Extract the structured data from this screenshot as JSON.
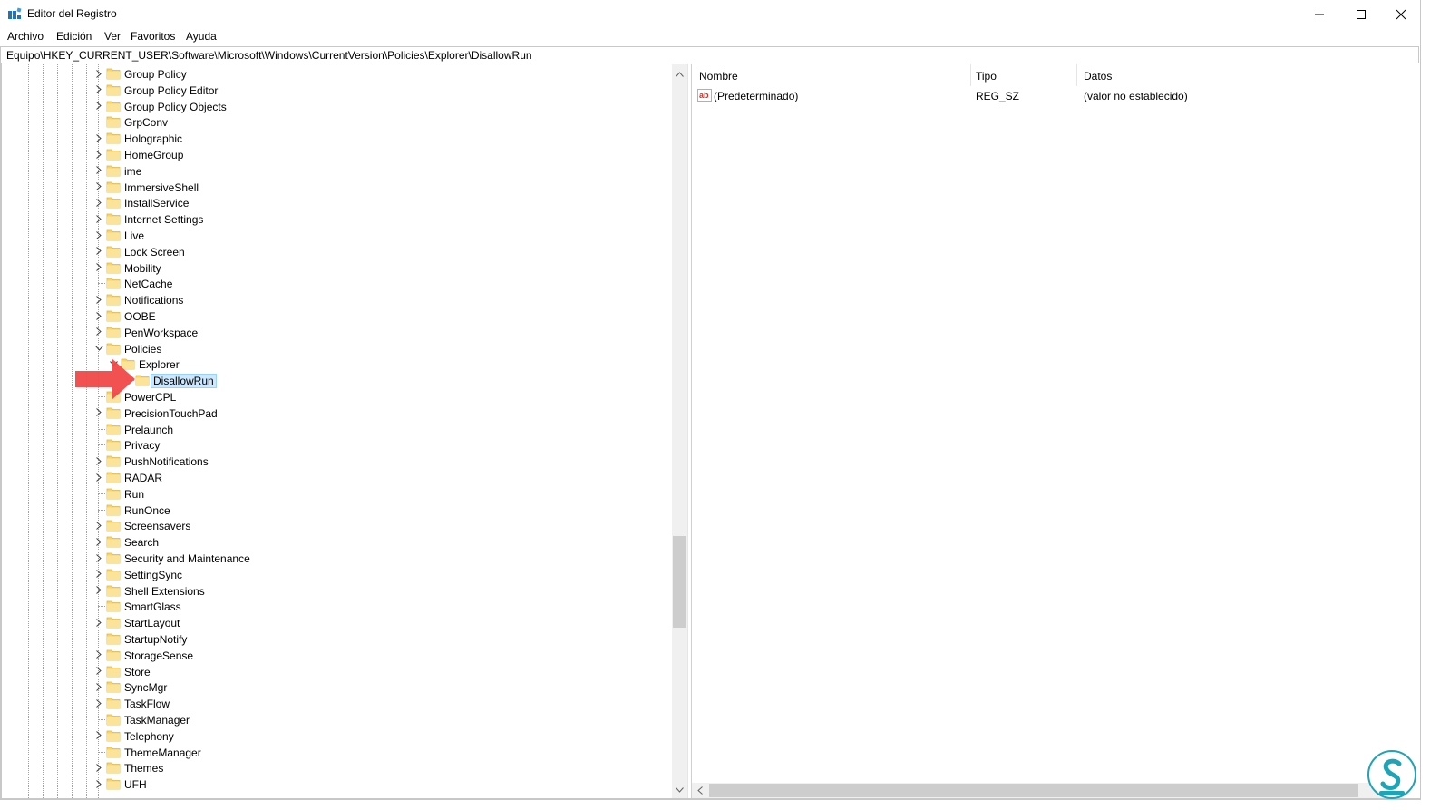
{
  "window": {
    "title": "Editor del Registro",
    "minimize_icon": "minimize-icon",
    "maximize_icon": "maximize-icon",
    "close_icon": "close-icon"
  },
  "menu": {
    "items": [
      "Archivo",
      "Edición",
      "Ver",
      "Favoritos",
      "Ayuda"
    ]
  },
  "address": {
    "path": "Equipo\\HKEY_CURRENT_USER\\Software\\Microsoft\\Windows\\CurrentVersion\\Policies\\Explorer\\DisallowRun"
  },
  "tree": {
    "items": [
      {
        "label": "Group Policy",
        "depth": 0,
        "expander": "collapsed"
      },
      {
        "label": "Group Policy Editor",
        "depth": 0,
        "expander": "collapsed"
      },
      {
        "label": "Group Policy Objects",
        "depth": 0,
        "expander": "collapsed"
      },
      {
        "label": "GrpConv",
        "depth": 0,
        "expander": "none"
      },
      {
        "label": "Holographic",
        "depth": 0,
        "expander": "collapsed"
      },
      {
        "label": "HomeGroup",
        "depth": 0,
        "expander": "collapsed"
      },
      {
        "label": "ime",
        "depth": 0,
        "expander": "collapsed"
      },
      {
        "label": "ImmersiveShell",
        "depth": 0,
        "expander": "collapsed"
      },
      {
        "label": "InstallService",
        "depth": 0,
        "expander": "collapsed"
      },
      {
        "label": "Internet Settings",
        "depth": 0,
        "expander": "collapsed"
      },
      {
        "label": "Live",
        "depth": 0,
        "expander": "collapsed"
      },
      {
        "label": "Lock Screen",
        "depth": 0,
        "expander": "collapsed"
      },
      {
        "label": "Mobility",
        "depth": 0,
        "expander": "collapsed"
      },
      {
        "label": "NetCache",
        "depth": 0,
        "expander": "none"
      },
      {
        "label": "Notifications",
        "depth": 0,
        "expander": "collapsed"
      },
      {
        "label": "OOBE",
        "depth": 0,
        "expander": "collapsed"
      },
      {
        "label": "PenWorkspace",
        "depth": 0,
        "expander": "collapsed"
      },
      {
        "label": "Policies",
        "depth": 0,
        "expander": "expanded"
      },
      {
        "label": "Explorer",
        "depth": 1,
        "expander": "expanded"
      },
      {
        "label": "DisallowRun",
        "depth": 2,
        "expander": "none",
        "selected": true
      },
      {
        "label": "PowerCPL",
        "depth": 0,
        "expander": "none"
      },
      {
        "label": "PrecisionTouchPad",
        "depth": 0,
        "expander": "collapsed"
      },
      {
        "label": "Prelaunch",
        "depth": 0,
        "expander": "none"
      },
      {
        "label": "Privacy",
        "depth": 0,
        "expander": "none"
      },
      {
        "label": "PushNotifications",
        "depth": 0,
        "expander": "collapsed"
      },
      {
        "label": "RADAR",
        "depth": 0,
        "expander": "collapsed"
      },
      {
        "label": "Run",
        "depth": 0,
        "expander": "none"
      },
      {
        "label": "RunOnce",
        "depth": 0,
        "expander": "none"
      },
      {
        "label": "Screensavers",
        "depth": 0,
        "expander": "collapsed"
      },
      {
        "label": "Search",
        "depth": 0,
        "expander": "collapsed"
      },
      {
        "label": "Security and Maintenance",
        "depth": 0,
        "expander": "collapsed"
      },
      {
        "label": "SettingSync",
        "depth": 0,
        "expander": "collapsed"
      },
      {
        "label": "Shell Extensions",
        "depth": 0,
        "expander": "collapsed"
      },
      {
        "label": "SmartGlass",
        "depth": 0,
        "expander": "none"
      },
      {
        "label": "StartLayout",
        "depth": 0,
        "expander": "collapsed"
      },
      {
        "label": "StartupNotify",
        "depth": 0,
        "expander": "none"
      },
      {
        "label": "StorageSense",
        "depth": 0,
        "expander": "collapsed"
      },
      {
        "label": "Store",
        "depth": 0,
        "expander": "collapsed"
      },
      {
        "label": "SyncMgr",
        "depth": 0,
        "expander": "collapsed"
      },
      {
        "label": "TaskFlow",
        "depth": 0,
        "expander": "collapsed"
      },
      {
        "label": "TaskManager",
        "depth": 0,
        "expander": "none"
      },
      {
        "label": "Telephony",
        "depth": 0,
        "expander": "collapsed"
      },
      {
        "label": "ThemeManager",
        "depth": 0,
        "expander": "none"
      },
      {
        "label": "Themes",
        "depth": 0,
        "expander": "collapsed"
      },
      {
        "label": "UFH",
        "depth": 0,
        "expander": "collapsed"
      }
    ]
  },
  "list": {
    "columns": [
      "Nombre",
      "Tipo",
      "Datos"
    ],
    "rows": [
      {
        "name": "(Predeterminado)",
        "type": "REG_SZ",
        "data": "(valor no establecido)",
        "icon": "string-value-icon"
      }
    ]
  },
  "colors": {
    "selection": "#cce8ff",
    "arrow": "#f04848",
    "folder": "#f7d56a",
    "logo": "#1fa3b5"
  }
}
